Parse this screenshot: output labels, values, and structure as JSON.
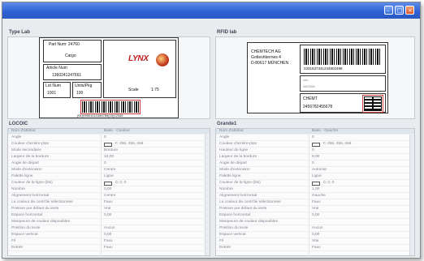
{
  "window": {
    "title": ""
  },
  "panels": {
    "type_lab": "Type Lab",
    "rfid_lab": "RFID lab",
    "left_props": "LOCOIC",
    "right_props": "Grande1"
  },
  "label1": {
    "part_num": "Part Num: 24760",
    "cargo": "Cargo",
    "article_num_title": "Article Num",
    "article_num": "1360241247661",
    "lot_num_title": "Lot Num",
    "lot_num": "1001",
    "units_title": "Units/Pkg",
    "units": "100",
    "scale": "Scale",
    "scale_val": "1:75",
    "logo": "LYNX",
    "barcode_text": "(01)09501012456789(10)12345"
  },
  "label2": {
    "address_line1": "CHEMTECH AG",
    "address_line2": "Gotteshbernes 4",
    "address_line3": "D-80617 MÜNCHEN",
    "barcode_text": "2331637341234802498",
    "info_line1": "info",
    "info_line2": "08/2008",
    "code_title": "CHEMT",
    "code": "2456782455678"
  },
  "left_grid": {
    "rows": [
      {
        "k": "Nom d'attribut",
        "v": "Base · Couleur"
      },
      {
        "k": "Angle",
        "v": "0"
      },
      {
        "k": "Couleur d'arrière-plan",
        "v": "F, 255, 255, 255"
      },
      {
        "k": "Mode secondaire",
        "v": "Bordure"
      },
      {
        "k": "Largeur de la bordure",
        "v": "10,00"
      },
      {
        "k": "Angle de départ",
        "v": "0"
      },
      {
        "k": "Mode d'extension",
        "v": "Centre"
      },
      {
        "k": "Palette ligne",
        "v": "Ligne"
      },
      {
        "k": "Couleur de la ligne (bis)",
        "v": "0, 0, 0"
      },
      {
        "k": "Nombre",
        "v": "0,00"
      },
      {
        "k": "Alignement horizontal",
        "v": "Centre"
      },
      {
        "k": "La couleur de contrôle sélectionnée",
        "v": "Faux"
      },
      {
        "k": "Position par défaut du texte",
        "v": "Vrai"
      },
      {
        "k": "Espace horizontal",
        "v": "0,00"
      },
      {
        "k": "Marqueurs de couleur disponibles",
        "v": ""
      },
      {
        "k": "Position du texte",
        "v": "Aucun"
      },
      {
        "k": "Espace vertical",
        "v": "0,00"
      },
      {
        "k": "Fil",
        "v": "Faux"
      },
      {
        "k": "Entrée",
        "v": "Faux"
      }
    ]
  },
  "right_grid": {
    "rows": [
      {
        "k": "Nom d'attribut",
        "v": "Base · Gauche"
      },
      {
        "k": "Angle",
        "v": "0"
      },
      {
        "k": "Couleur d'arrière-plan",
        "v": "F, 255, 255, 255"
      },
      {
        "k": "Hauteur de ligne",
        "v": "0"
      },
      {
        "k": "Largeur de la bordure",
        "v": "8,00"
      },
      {
        "k": "Angle de départ",
        "v": "0"
      },
      {
        "k": "Mode d'extension",
        "v": "Automat"
      },
      {
        "k": "Palette ligne",
        "v": "Ligne"
      },
      {
        "k": "Couleur de la ligne (bis)",
        "v": "0, 0, 0"
      },
      {
        "k": "Nombre",
        "v": "1,00"
      },
      {
        "k": "Alignement horizontal",
        "v": "Gauche"
      },
      {
        "k": "La couleur de contrôle sélectionnée",
        "v": "Faux"
      },
      {
        "k": "Position par défaut du texte",
        "v": "Vrai"
      },
      {
        "k": "Espace horizontal",
        "v": "0,00"
      },
      {
        "k": "Marqueurs de couleur disponibles",
        "v": ""
      },
      {
        "k": "Position du texte",
        "v": "Aucun"
      },
      {
        "k": "Espace vertical",
        "v": "0,00"
      },
      {
        "k": "Fil",
        "v": "Vrai"
      },
      {
        "k": "Entrée",
        "v": "Faux"
      }
    ]
  },
  "colors": {
    "titlebar": "#2f62d6",
    "accent_red": "#c21d1d"
  }
}
